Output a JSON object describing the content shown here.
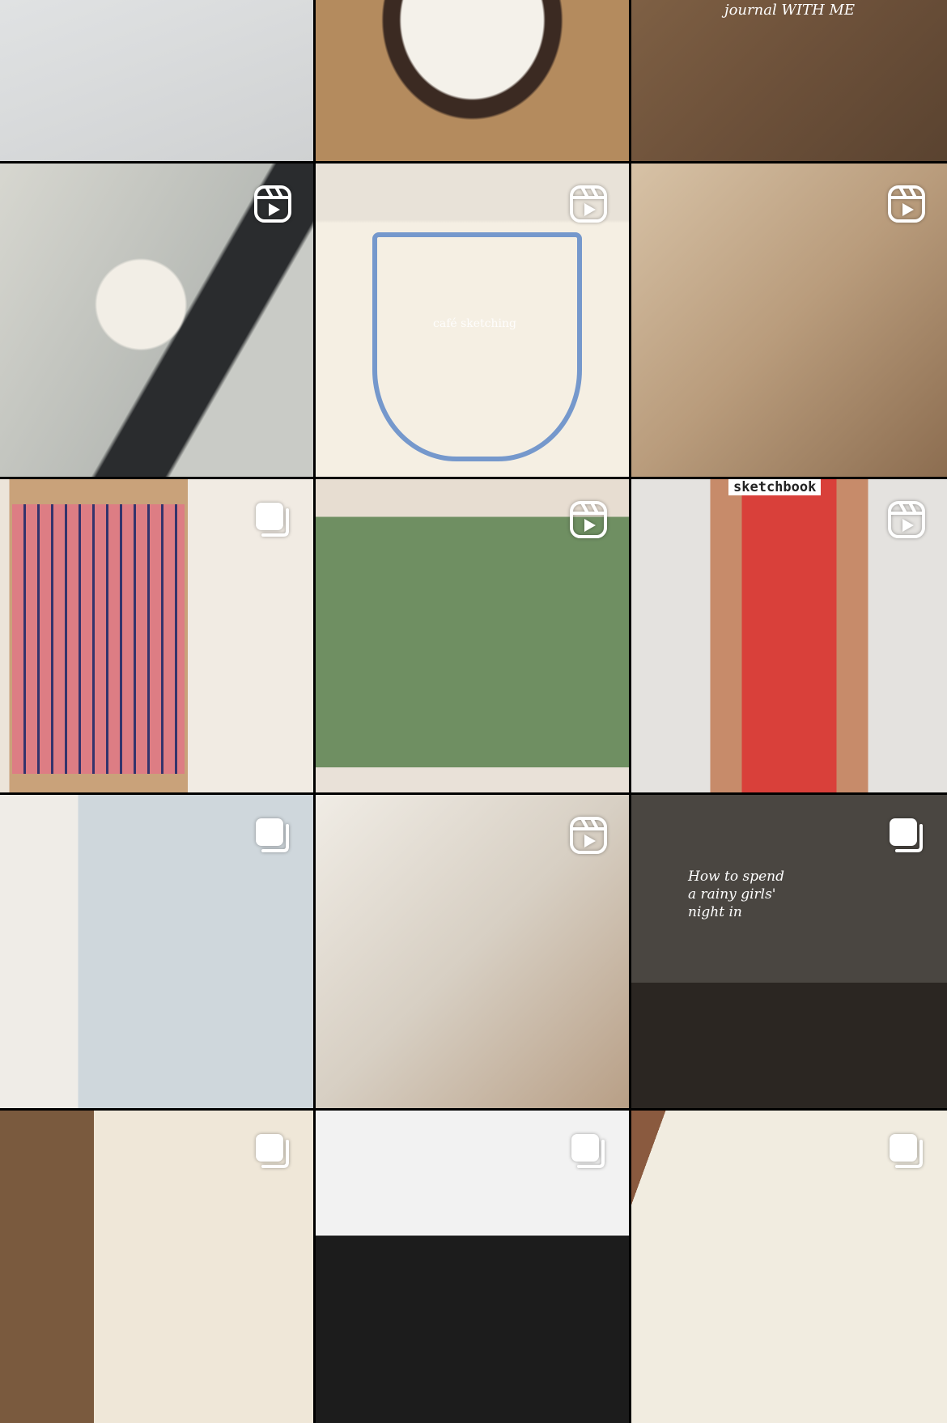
{
  "grid": {
    "columns": 3,
    "tiles": [
      {
        "id": 0,
        "badge": "none"
      },
      {
        "id": 1,
        "badge": "none"
      },
      {
        "id": 2,
        "badge": "none"
      },
      {
        "id": 3,
        "badge": "reels-icon"
      },
      {
        "id": 4,
        "badge": "reels-icon",
        "caption": "café sketching"
      },
      {
        "id": 5,
        "badge": "reels-icon"
      },
      {
        "id": 6,
        "badge": "carousel-icon"
      },
      {
        "id": 7,
        "badge": "reels-icon"
      },
      {
        "id": 8,
        "badge": "reels-icon",
        "caption": "sketchbook"
      },
      {
        "id": 9,
        "badge": "carousel-icon"
      },
      {
        "id": 10,
        "badge": "reels-icon"
      },
      {
        "id": 11,
        "badge": "carousel-icon",
        "caption": "How to spend a rainy girls' night in"
      },
      {
        "id": 12,
        "badge": "carousel-icon"
      },
      {
        "id": 13,
        "badge": "carousel-icon"
      },
      {
        "id": 14,
        "badge": "carousel-icon"
      }
    ]
  },
  "texts": {
    "journal_with_me": "journal WITH ME"
  }
}
